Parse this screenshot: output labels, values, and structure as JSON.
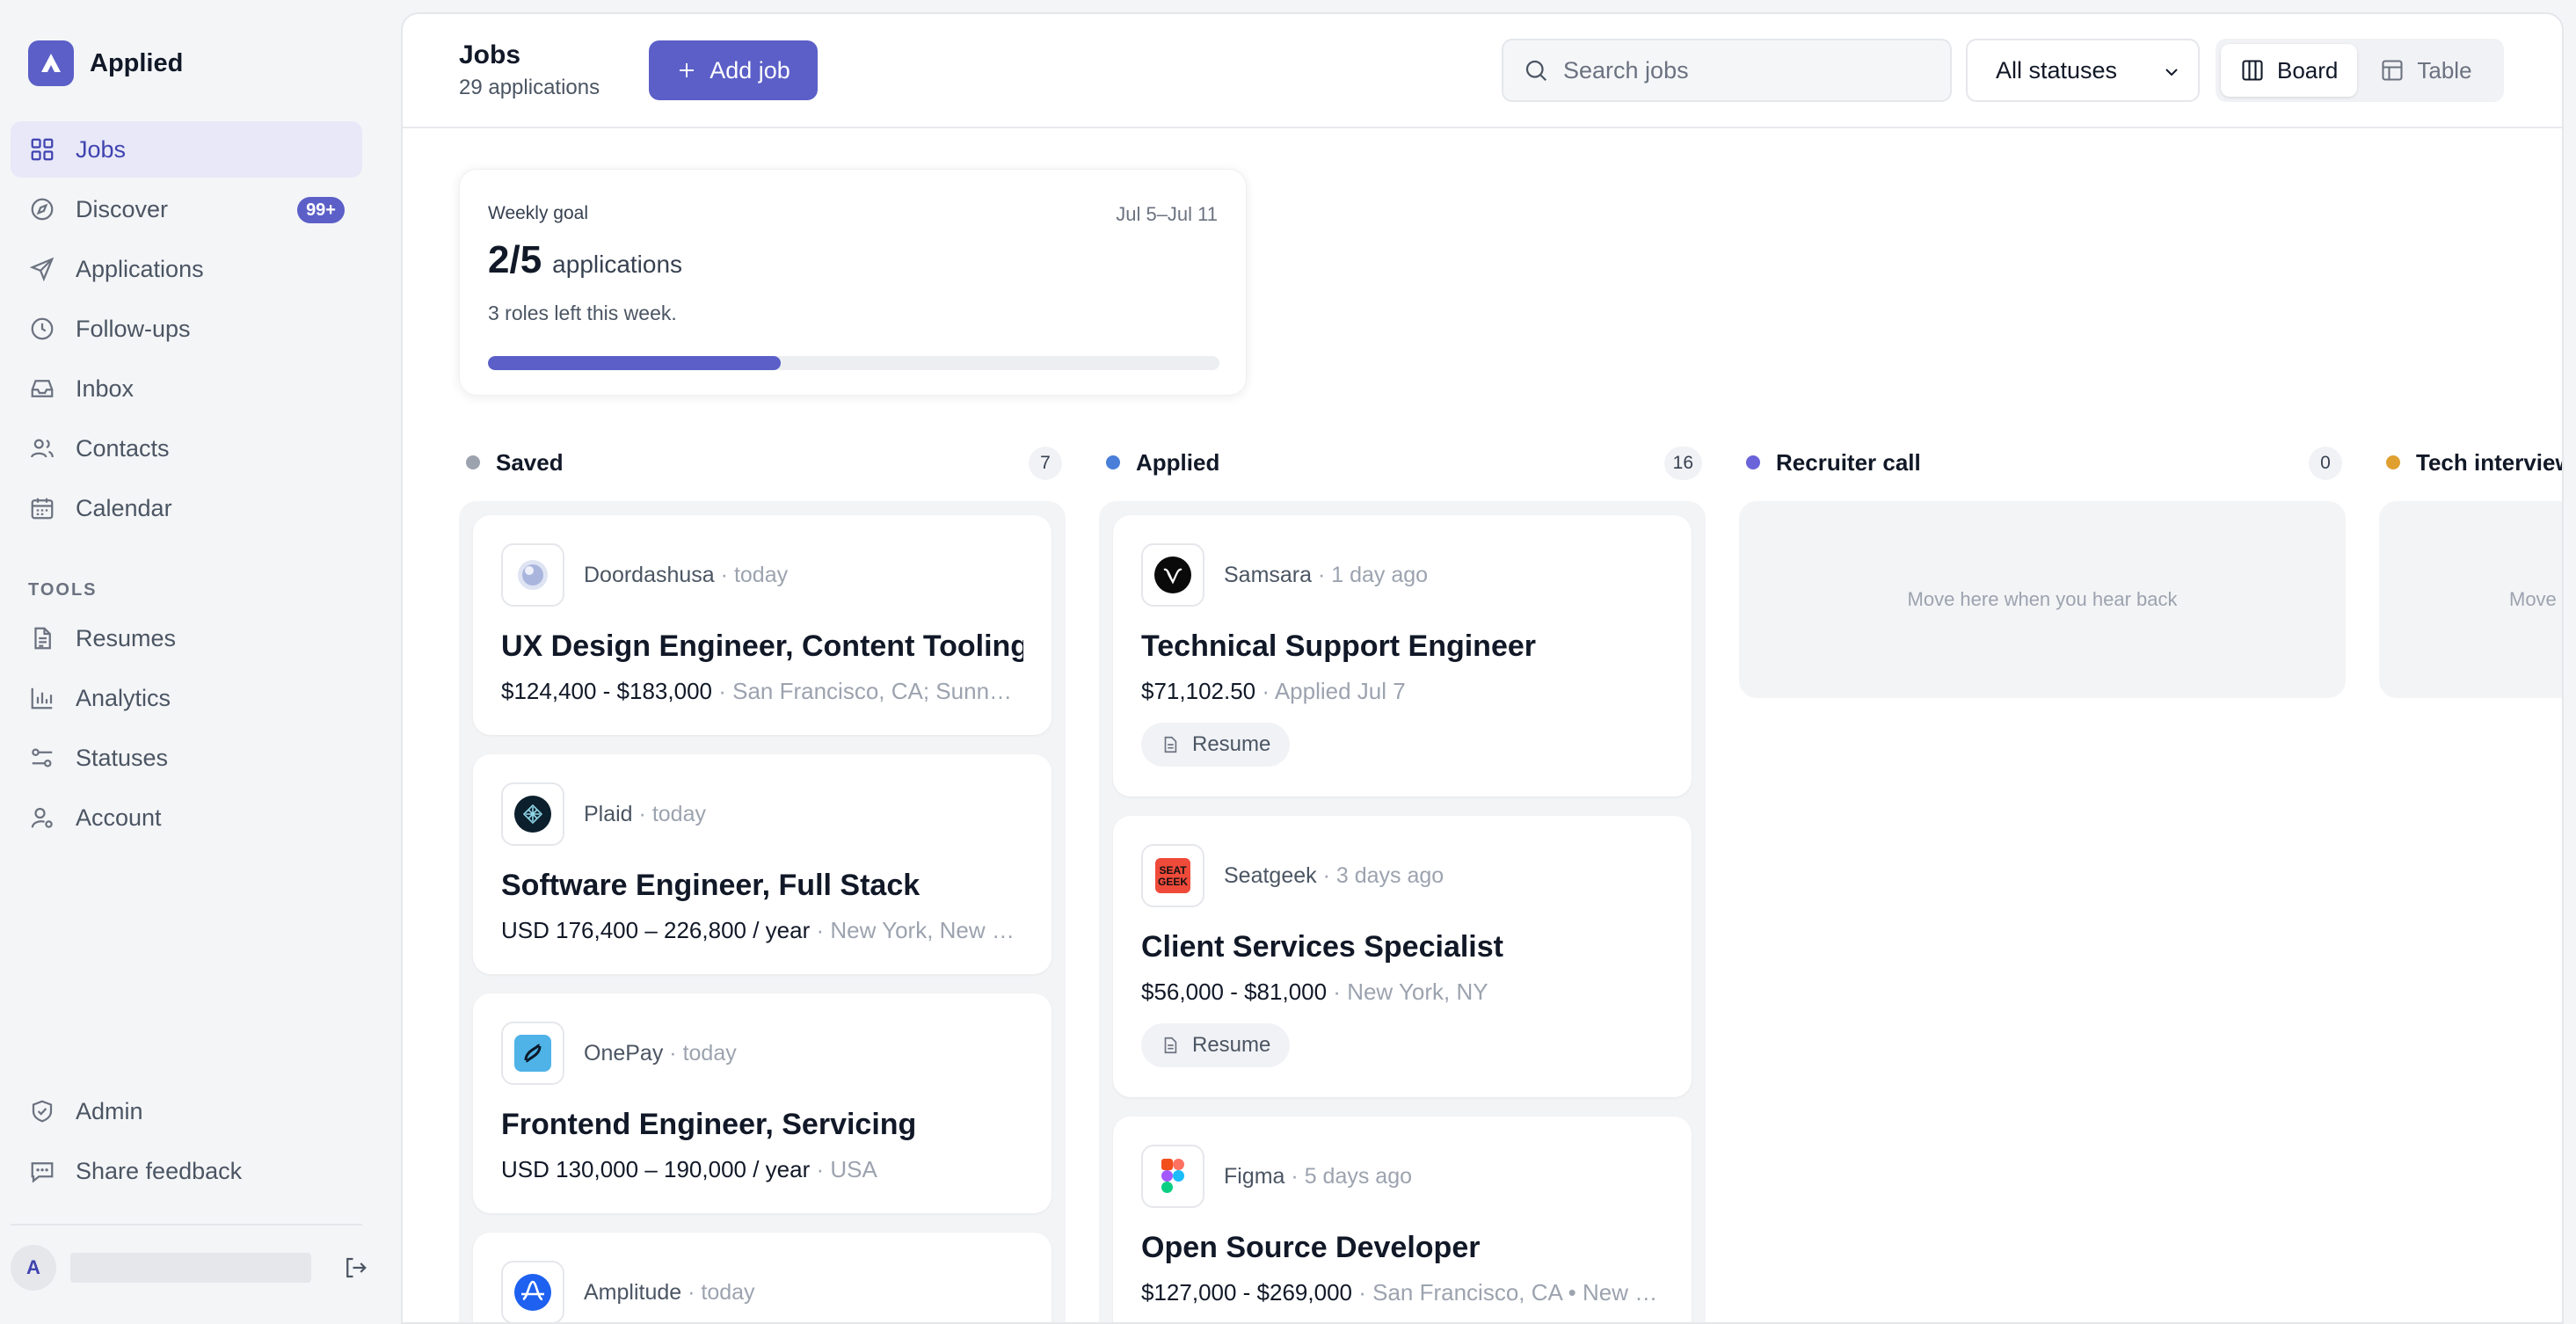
{
  "app": {
    "name": "Applied"
  },
  "sidebar": {
    "nav": [
      {
        "label": "Jobs",
        "icon": "grid-icon",
        "active": true
      },
      {
        "label": "Discover",
        "icon": "compass-icon",
        "badge": "99+"
      },
      {
        "label": "Applications",
        "icon": "send-icon"
      },
      {
        "label": "Follow-ups",
        "icon": "clock-icon"
      },
      {
        "label": "Inbox",
        "icon": "inbox-icon"
      },
      {
        "label": "Contacts",
        "icon": "users-icon"
      },
      {
        "label": "Calendar",
        "icon": "calendar-icon"
      }
    ],
    "tools_label": "TOOLS",
    "tools": [
      {
        "label": "Resumes",
        "icon": "document-icon"
      },
      {
        "label": "Analytics",
        "icon": "bar-chart-icon"
      },
      {
        "label": "Statuses",
        "icon": "sliders-icon"
      },
      {
        "label": "Account",
        "icon": "user-gear-icon"
      }
    ],
    "bottom": [
      {
        "label": "Admin",
        "icon": "shield-check-icon"
      },
      {
        "label": "Share feedback",
        "icon": "message-icon"
      }
    ],
    "user_initial": "A"
  },
  "header": {
    "title": "Jobs",
    "subtitle": "29 applications",
    "add_label": "Add job",
    "search_placeholder": "Search jobs",
    "status_filter": "All statuses",
    "view_board": "Board",
    "view_table": "Table"
  },
  "goal": {
    "label": "Weekly goal",
    "range": "Jul 5–Jul 11",
    "count": "2/5",
    "unit": "applications",
    "note": "3 roles left this week.",
    "progress": 0.4
  },
  "columns": {
    "saved": {
      "title": "Saved",
      "count": "7",
      "color": "#9ca3af",
      "cards": [
        {
          "company": "Doordashusa",
          "ago": "today",
          "title": "UX Design Engineer, Content Tooling",
          "salary": "$124,400 - $183,000",
          "detail": "San Francisco, CA; Sunn…",
          "logo": "doordash-logo"
        },
        {
          "company": "Plaid",
          "ago": "today",
          "title": "Software Engineer, Full Stack",
          "salary": "USD 176,400 – 226,800 / year",
          "detail": "New York, New …",
          "logo": "plaid-logo"
        },
        {
          "company": "OnePay",
          "ago": "today",
          "title": "Frontend Engineer, Servicing",
          "salary": "USD 130,000 – 190,000 / year",
          "detail": "USA",
          "logo": "onepay-logo"
        },
        {
          "company": "Amplitude",
          "ago": "today",
          "title": "",
          "salary": "",
          "detail": "",
          "logo": "amplitude-logo"
        }
      ]
    },
    "applied": {
      "title": "Applied",
      "count": "16",
      "color": "#4a7fd9",
      "cards": [
        {
          "company": "Samsara",
          "ago": "1 day ago",
          "title": "Technical Support Engineer",
          "salary": "$71,102.50",
          "detail": "Applied Jul 7",
          "resume": "Resume",
          "logo": "samsara-logo"
        },
        {
          "company": "Seatgeek",
          "ago": "3 days ago",
          "title": "Client Services Specialist",
          "salary": "$56,000 - $81,000",
          "detail": "New York, NY",
          "resume": "Resume",
          "logo": "seatgeek-logo",
          "logo_text": "SEAT GEEK"
        },
        {
          "company": "Figma",
          "ago": "5 days ago",
          "title": "Open Source Developer",
          "salary": "$127,000 - $269,000",
          "detail": "San Francisco, CA • New …",
          "logo": "figma-logo"
        }
      ]
    },
    "recruiter": {
      "title": "Recruiter call",
      "count": "0",
      "color": "#6b63d9",
      "empty": "Move here when you hear back"
    },
    "tech": {
      "title": "Tech interview",
      "color": "#e0a030",
      "empty": "Move"
    }
  }
}
